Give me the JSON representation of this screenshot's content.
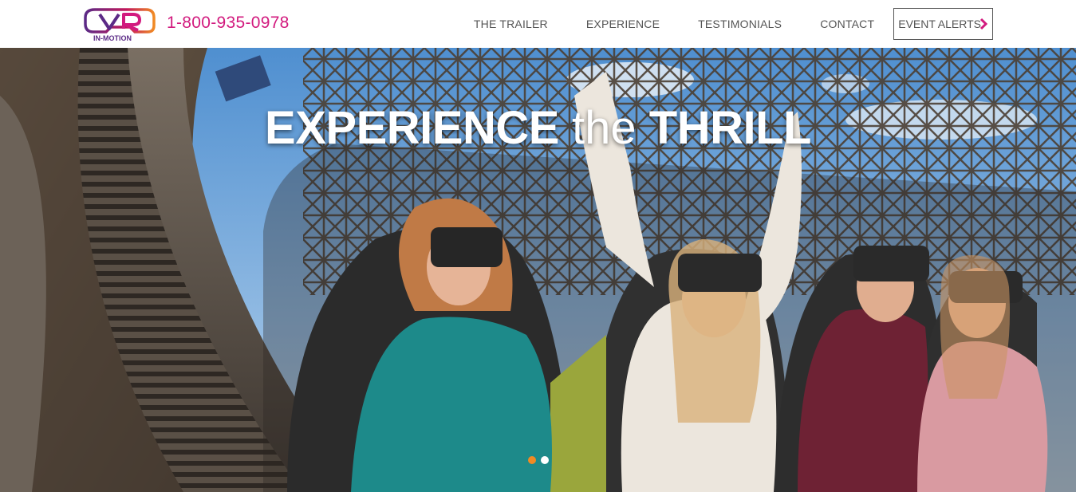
{
  "header": {
    "logo": {
      "icon": "vr-logo-icon",
      "text": "IN-MOTION"
    },
    "phone": "1-800-935-0978",
    "nav": [
      {
        "label": "THE TRAILER"
      },
      {
        "label": "EXPERIENCE"
      },
      {
        "label": "TESTIMONIALS"
      },
      {
        "label": "CONTACT"
      }
    ],
    "event_alerts": {
      "label": "EVENT ALERTS",
      "icon": "chevron-right-icon"
    }
  },
  "hero": {
    "headline_strong_1": "EXPERIENCE",
    "headline_light": "the",
    "headline_strong_2": "THRILL",
    "image": "riders-in-vr-headsets-on-roller-coaster",
    "carousel": {
      "slide_count": 2,
      "active_index": 0
    }
  },
  "colors": {
    "brand_pink": "#d21a7e",
    "brand_purple": "#5b2a86",
    "dot_active": "#f08a24",
    "dot_inactive": "#ffffff",
    "nav_text": "#555555"
  }
}
